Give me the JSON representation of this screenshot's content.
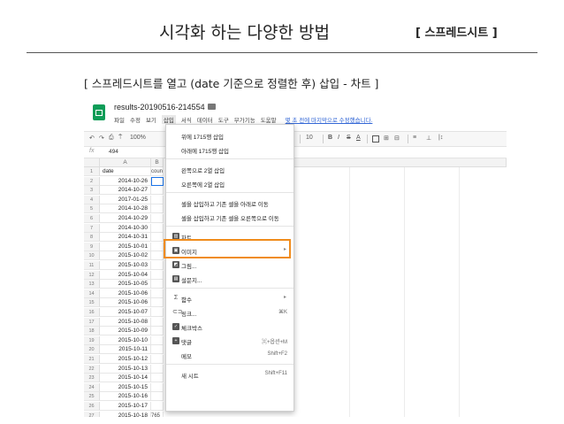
{
  "slide": {
    "title": "시각화 하는 다양한 방법",
    "tag": "[ 스프레드시트 ]",
    "subtitle": "[ 스프레드시트를 열고 (date 기준으로 정렬한 후) 삽입 - 차트 ]"
  },
  "sheet": {
    "doc_title": "results-20190516-214554",
    "star_icon": "☆",
    "menus": [
      "파일",
      "수정",
      "보기",
      "삽입",
      "서식",
      "데이터",
      "도구",
      "부가기능",
      "도움말"
    ],
    "active_menu_index": 3,
    "last_edit": "몇 초 전에 마지막으로 수정했습니다.",
    "toolbar": {
      "undo": "↶",
      "redo": "↷",
      "print": "⎙",
      "paint": "⍑",
      "zoom": "100%",
      "font_size": "10",
      "bold": "B",
      "italic": "I",
      "strike": "S",
      "text_color": "A",
      "fill": "",
      "borders": "⊞",
      "merge": "⊟",
      "align": "≡",
      "valign": "⊥",
      "rotate": "|↕"
    },
    "formula": {
      "fx": "fx",
      "value": "494"
    },
    "columns": {
      "a": "A",
      "b": "B"
    },
    "header_row": {
      "a": "date",
      "b": "count"
    },
    "rows": [
      {
        "num": "1",
        "a": "date",
        "b": "count"
      },
      {
        "num": "2",
        "a": "2014-10-26",
        "b": ""
      },
      {
        "num": "3",
        "a": "2014-10-27",
        "b": ""
      },
      {
        "num": "4",
        "a": "2017-01-25",
        "b": ""
      },
      {
        "num": "5",
        "a": "2014-10-28",
        "b": ""
      },
      {
        "num": "6",
        "a": "2014-10-29",
        "b": ""
      },
      {
        "num": "7",
        "a": "2014-10-30",
        "b": ""
      },
      {
        "num": "8",
        "a": "2014-10-31",
        "b": ""
      },
      {
        "num": "9",
        "a": "2015-10-01",
        "b": ""
      },
      {
        "num": "10",
        "a": "2015-10-02",
        "b": ""
      },
      {
        "num": "11",
        "a": "2015-10-03",
        "b": ""
      },
      {
        "num": "12",
        "a": "2015-10-04",
        "b": ""
      },
      {
        "num": "13",
        "a": "2015-10-05",
        "b": ""
      },
      {
        "num": "14",
        "a": "2015-10-06",
        "b": ""
      },
      {
        "num": "15",
        "a": "2015-10-06",
        "b": ""
      },
      {
        "num": "16",
        "a": "2015-10-07",
        "b": ""
      },
      {
        "num": "17",
        "a": "2015-10-08",
        "b": ""
      },
      {
        "num": "18",
        "a": "2015-10-09",
        "b": ""
      },
      {
        "num": "19",
        "a": "2015-10-10",
        "b": ""
      },
      {
        "num": "20",
        "a": "2015-10-11",
        "b": ""
      },
      {
        "num": "21",
        "a": "2015-10-12",
        "b": ""
      },
      {
        "num": "22",
        "a": "2015-10-13",
        "b": ""
      },
      {
        "num": "23",
        "a": "2015-10-14",
        "b": ""
      },
      {
        "num": "24",
        "a": "2015-10-15",
        "b": ""
      },
      {
        "num": "25",
        "a": "2015-10-16",
        "b": ""
      },
      {
        "num": "26",
        "a": "2015-10-17",
        "b": ""
      },
      {
        "num": "27",
        "a": "2015-10-18",
        "b": "765"
      }
    ],
    "insert_menu": [
      {
        "id": "row-above",
        "label": "위에 1715행 삽입",
        "icon": "",
        "shortcut": "",
        "arrow": false
      },
      {
        "id": "row-below",
        "label": "아래에 1715행 삽입",
        "icon": "",
        "shortcut": "",
        "arrow": false
      },
      {
        "sep": true
      },
      {
        "id": "col-left",
        "label": "왼쪽으로 2열 삽입",
        "icon": "",
        "shortcut": "",
        "arrow": false
      },
      {
        "id": "col-right",
        "label": "오른쪽에 2열 삽입",
        "icon": "",
        "shortcut": "",
        "arrow": false
      },
      {
        "sep": true
      },
      {
        "id": "cells-shift-down",
        "label": "셀을 삽입하고 기존 셀을 아래로 이동",
        "icon": "",
        "shortcut": "",
        "arrow": false
      },
      {
        "id": "cells-shift-right",
        "label": "셀을 삽입하고 기존 셀을 오른쪽으로 이동",
        "icon": "",
        "shortcut": "",
        "arrow": false
      },
      {
        "sep": true
      },
      {
        "id": "chart",
        "label": "차트",
        "icon": "chart-icon",
        "glyph": "▥",
        "shortcut": "",
        "arrow": false
      },
      {
        "id": "image",
        "label": "이미지",
        "icon": "image-icon",
        "glyph": "▣",
        "shortcut": "",
        "arrow": true
      },
      {
        "id": "drawing",
        "label": "그림...",
        "icon": "drawing-icon",
        "glyph": "◩",
        "shortcut": "",
        "arrow": false
      },
      {
        "id": "form",
        "label": "설문지...",
        "icon": "form-icon",
        "glyph": "▤",
        "shortcut": "",
        "arrow": false
      },
      {
        "sep": true
      },
      {
        "id": "function",
        "label": "함수",
        "icon": "sigma-icon",
        "glyph": "Σ",
        "shortcut": "",
        "arrow": true
      },
      {
        "id": "link",
        "label": "링크...",
        "icon": "link-icon",
        "glyph": "⊂⊃",
        "shortcut": "⌘K",
        "arrow": false
      },
      {
        "id": "checkbox",
        "label": "체크박스",
        "icon": "checkbox-icon",
        "glyph": "✓",
        "shortcut": "",
        "arrow": false
      },
      {
        "id": "comment",
        "label": "댓글",
        "icon": "comment-icon",
        "glyph": "+",
        "shortcut": "⌘+옵션+M",
        "arrow": false
      },
      {
        "id": "note",
        "label": "메모",
        "icon": "",
        "shortcut": "Shift+F2",
        "arrow": false
      },
      {
        "sep": true
      },
      {
        "id": "new-sheet",
        "label": "새 시트",
        "icon": "",
        "shortcut": "Shift+F11",
        "arrow": false
      }
    ]
  }
}
